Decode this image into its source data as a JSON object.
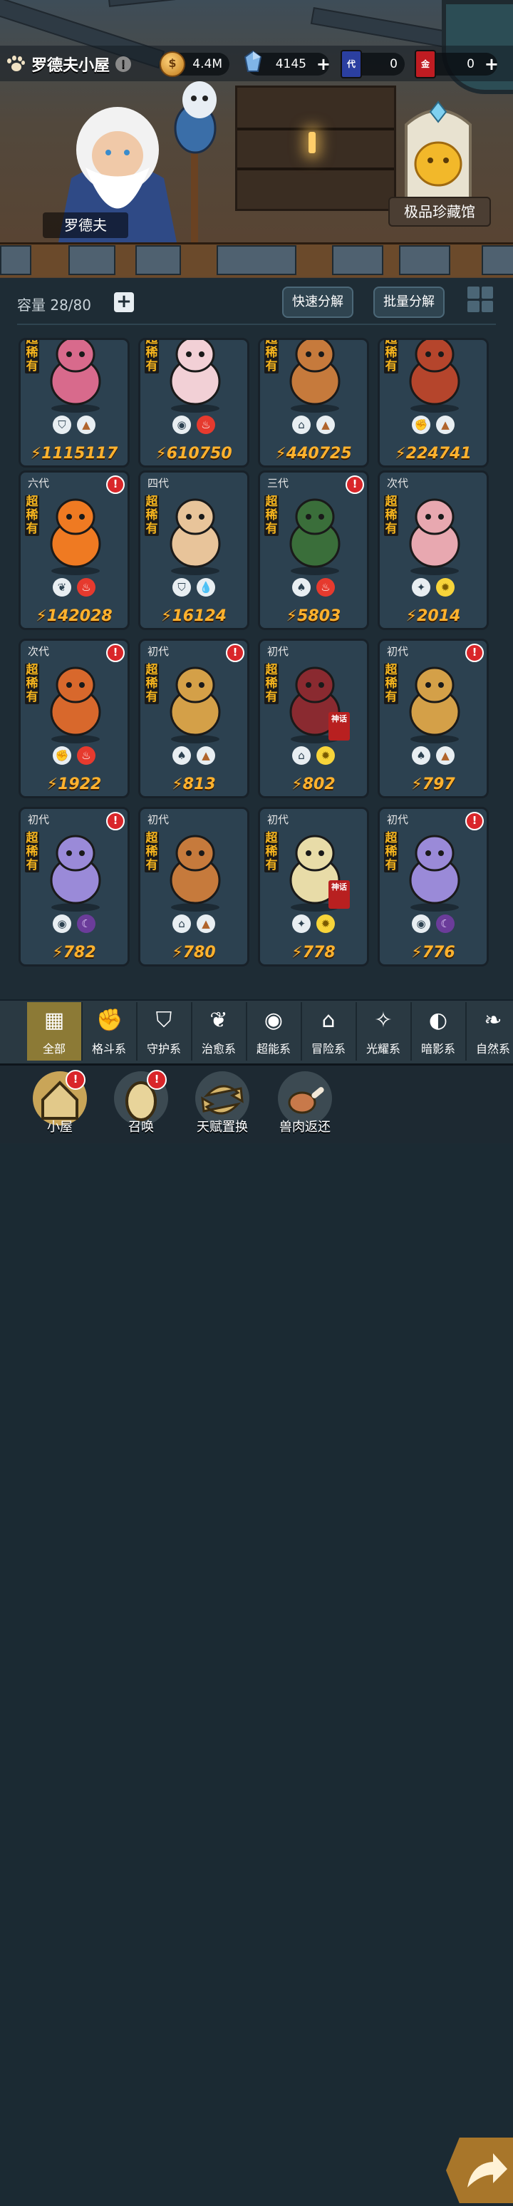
{
  "header": {
    "title": "罗德夫小屋",
    "info": "!",
    "gold": "4.4M",
    "gems": "4145",
    "ticket_a": "0",
    "ticket_b": "0",
    "ticket_a_glyph": "代",
    "ticket_b_glyph": "金"
  },
  "scene": {
    "npc_name": "罗德夫",
    "collection_label": "极品珍藏馆"
  },
  "inventory": {
    "capacity_label": "容量 28/80",
    "quick_decompose": "快速分解",
    "batch_decompose": "批量分解"
  },
  "rarity_text": "超稀有",
  "cards": [
    {
      "gen": "",
      "alert": false,
      "power": "1115117",
      "elems": [
        "shield",
        "meat"
      ],
      "color": "#d86a8c"
    },
    {
      "gen": "",
      "alert": false,
      "power": "610750",
      "elems": [
        "psychic",
        "fire"
      ],
      "color": "#f2d0d6"
    },
    {
      "gen": "",
      "alert": false,
      "power": "440725",
      "elems": [
        "adventure",
        "meat"
      ],
      "color": "#c67a3c"
    },
    {
      "gen": "",
      "alert": false,
      "power": "224741",
      "elems": [
        "fight",
        "meat"
      ],
      "color": "#b5452c"
    },
    {
      "gen": "六代",
      "alert": true,
      "power": "142028",
      "elems": [
        "plant",
        "fire"
      ],
      "color": "#ef7a22"
    },
    {
      "gen": "四代",
      "alert": false,
      "power": "16124",
      "elems": [
        "shield",
        "water"
      ],
      "color": "#e8c49a"
    },
    {
      "gen": "三代",
      "alert": true,
      "power": "5803",
      "elems": [
        "leaf",
        "fire"
      ],
      "color": "#3a6e3a"
    },
    {
      "gen": "次代",
      "alert": false,
      "power": "2014",
      "elems": [
        "shine",
        "light"
      ],
      "color": "#e8a8b0"
    },
    {
      "gen": "次代",
      "alert": true,
      "power": "1922",
      "elems": [
        "fight",
        "fire"
      ],
      "color": "#d8682c"
    },
    {
      "gen": "初代",
      "alert": true,
      "power": "813",
      "elems": [
        "leaf",
        "meat"
      ],
      "color": "#d4a048"
    },
    {
      "gen": "初代",
      "alert": false,
      "power": "802",
      "elems": [
        "adventure",
        "light"
      ],
      "color": "#8a2a30"
    },
    {
      "gen": "初代",
      "alert": true,
      "power": "797",
      "elems": [
        "leaf",
        "meat"
      ],
      "color": "#d4a048"
    },
    {
      "gen": "初代",
      "alert": true,
      "power": "782",
      "elems": [
        "dark-eye",
        "dark"
      ],
      "color": "#9a8ad8"
    },
    {
      "gen": "初代",
      "alert": false,
      "power": "780",
      "elems": [
        "adventure",
        "meat"
      ],
      "color": "#c67a3c"
    },
    {
      "gen": "初代",
      "alert": false,
      "power": "778",
      "elems": [
        "shine",
        "light"
      ],
      "color": "#e8dca8"
    },
    {
      "gen": "初代",
      "alert": true,
      "power": "776",
      "elems": [
        "dark-eye",
        "dark"
      ],
      "color": "#9a8ad8"
    }
  ],
  "categories": [
    {
      "label": "全部",
      "icon": "▦"
    },
    {
      "label": "格斗系",
      "icon": "✊"
    },
    {
      "label": "守护系",
      "icon": "⛉"
    },
    {
      "label": "治愈系",
      "icon": "❦"
    },
    {
      "label": "超能系",
      "icon": "◉"
    },
    {
      "label": "冒险系",
      "icon": "⌂"
    },
    {
      "label": "光耀系",
      "icon": "✧"
    },
    {
      "label": "暗影系",
      "icon": "◐"
    },
    {
      "label": "自然系",
      "icon": "❧"
    }
  ],
  "nav": {
    "home": "小屋",
    "summon": "召唤",
    "talent": "天赋置换",
    "meat": "兽肉返还",
    "alert": "!"
  }
}
